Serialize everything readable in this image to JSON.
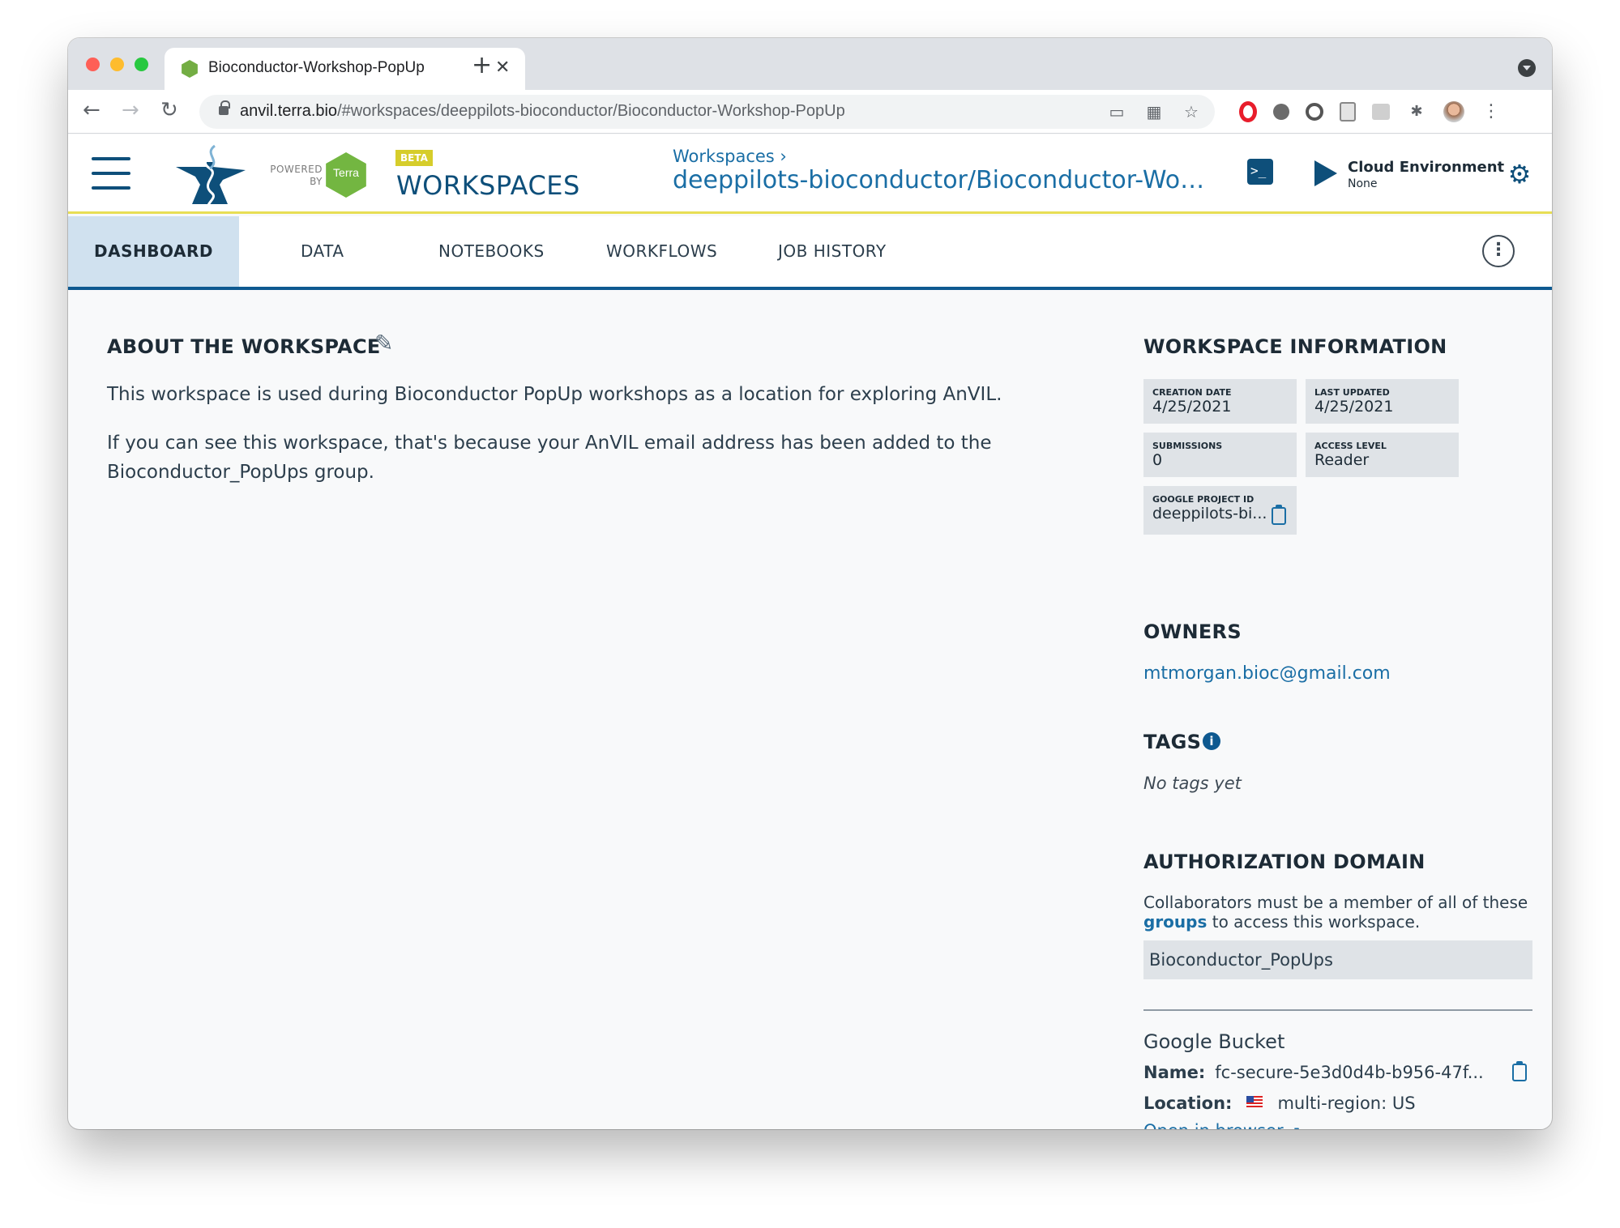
{
  "browser": {
    "tab_title": "Bioconductor-Workshop-PopUp",
    "tab_close": "✕",
    "new_tab": "+",
    "url_host": "anvil.terra.bio",
    "url_path": "/#workspaces/deeppilots-bioconductor/Bioconductor-Workshop-PopUp"
  },
  "header": {
    "powered_by_line1": "POWERED",
    "powered_by_line2": "BY",
    "terra_logo_text": "Terra",
    "beta": "BETA",
    "app_name": "WORKSPACES",
    "breadcrumb_parent": "Workspaces ›",
    "breadcrumb_current": "deeppilots-bioconductor/Bioconductor-Workshop-PopUp",
    "cloud_env_title": "Cloud Environment",
    "cloud_env_status": "None"
  },
  "tabs": [
    {
      "label": "DASHBOARD",
      "active": true
    },
    {
      "label": "DATA"
    },
    {
      "label": "NOTEBOOKS"
    },
    {
      "label": "WORKFLOWS"
    },
    {
      "label": "JOB HISTORY"
    }
  ],
  "about": {
    "title": "ABOUT THE WORKSPACE",
    "paragraph1": "This workspace is used during Bioconductor PopUp workshops as a location for exploring AnVIL.",
    "paragraph2": "If you can see this workspace, that's because your AnVIL email address has been added to the Bioconductor_PopUps group."
  },
  "workspace_info": {
    "title": "WORKSPACE INFORMATION",
    "creation_date_label": "CREATION DATE",
    "creation_date": "4/25/2021",
    "last_updated_label": "LAST UPDATED",
    "last_updated": "4/25/2021",
    "submissions_label": "SUBMISSIONS",
    "submissions": "0",
    "access_level_label": "ACCESS LEVEL",
    "access_level": "Reader",
    "project_id_label": "GOOGLE PROJECT ID",
    "project_id": "deeppilots-bi..."
  },
  "owners": {
    "title": "OWNERS",
    "email": "mtmorgan.bioc@gmail.com"
  },
  "tags": {
    "title": "TAGS",
    "empty_text": "No tags yet"
  },
  "auth_domain": {
    "title": "AUTHORIZATION DOMAIN",
    "desc_before": "Collaborators must be a member of all of these ",
    "desc_link": "groups",
    "desc_after": " to access this workspace.",
    "group": "Bioconductor_PopUps"
  },
  "bucket": {
    "title": "Google Bucket",
    "name_label": "Name:",
    "name_value": "fc-secure-5e3d0d4b-b956-47f...",
    "location_label": "Location:",
    "location_value": "multi-region: US",
    "open_link": "Open in browser"
  },
  "colors": {
    "brand_dark": "#0e4f7a",
    "link": "#1a6ea5",
    "active_tab_bg": "#d0e1ef",
    "header_accent": "#e8de55",
    "terra_green": "#73b641"
  }
}
